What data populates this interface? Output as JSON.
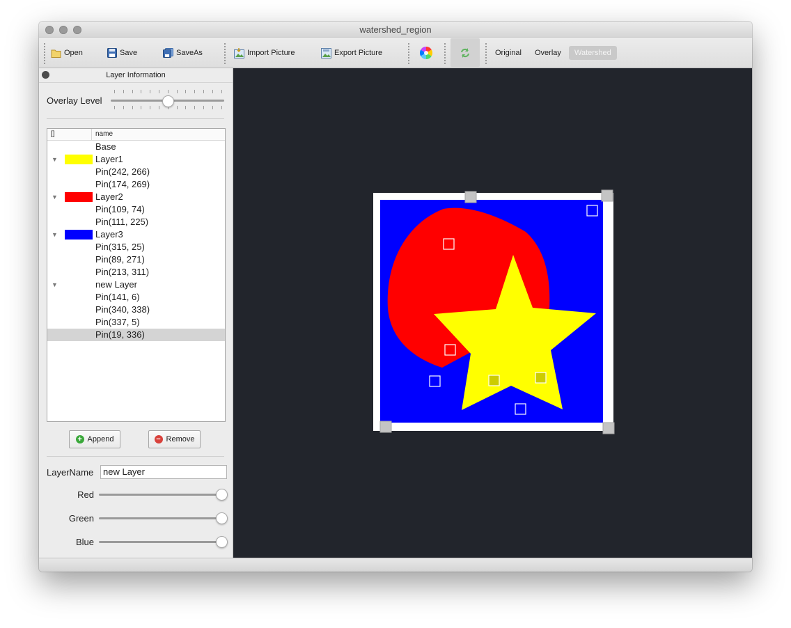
{
  "window": {
    "title": "watershed_region"
  },
  "toolbar": {
    "open": "Open",
    "save": "Save",
    "save_as": "SaveAs",
    "import_picture": "Import Picture",
    "export_picture": "Export Picture",
    "modes": [
      {
        "label": "Original",
        "active": false
      },
      {
        "label": "Overlay",
        "active": false
      },
      {
        "label": "Watershed",
        "active": true
      }
    ]
  },
  "sidebar": {
    "panel_title": "Layer Information",
    "overlay_label": "Overlay Level",
    "overlay_level": 0.5,
    "tree": {
      "headers": [
        "[]",
        "name"
      ],
      "rows": [
        {
          "label": "Base",
          "expander": "",
          "color": ""
        },
        {
          "label": "Layer1",
          "expander": "▼",
          "color": "#ffff00"
        },
        {
          "label": "Pin(242, 266)",
          "expander": "",
          "color": ""
        },
        {
          "label": "Pin(174, 269)",
          "expander": "",
          "color": ""
        },
        {
          "label": "Layer2",
          "expander": "▼",
          "color": "#ff0000"
        },
        {
          "label": "Pin(109, 74)",
          "expander": "",
          "color": ""
        },
        {
          "label": "Pin(111, 225)",
          "expander": "",
          "color": ""
        },
        {
          "label": "Layer3",
          "expander": "▼",
          "color": "#0000ff"
        },
        {
          "label": "Pin(315, 25)",
          "expander": "",
          "color": ""
        },
        {
          "label": "Pin(89, 271)",
          "expander": "",
          "color": ""
        },
        {
          "label": "Pin(213, 311)",
          "expander": "",
          "color": ""
        },
        {
          "label": "new Layer",
          "expander": "▼",
          "color": ""
        },
        {
          "label": "Pin(141, 6)",
          "expander": "",
          "color": ""
        },
        {
          "label": "Pin(340, 338)",
          "expander": "",
          "color": ""
        },
        {
          "label": "Pin(337, 5)",
          "expander": "",
          "color": ""
        },
        {
          "label": "Pin(19, 336)",
          "expander": "",
          "color": "",
          "selected": true
        }
      ]
    },
    "append": "Append",
    "remove": "Remove",
    "layer_name_label": "LayerName",
    "layer_name_value": "new Layer",
    "red_label": "Red",
    "green_label": "Green",
    "blue_label": "Blue",
    "red_value": 255,
    "green_value": 255,
    "blue_value": 255
  },
  "colors": {
    "canvas_bg": "#22252c",
    "region_blue": "#0000ff",
    "region_red": "#ff0000",
    "region_yellow": "#ffff00",
    "add_green": "#3aa83a",
    "remove_red": "#d8413b"
  }
}
